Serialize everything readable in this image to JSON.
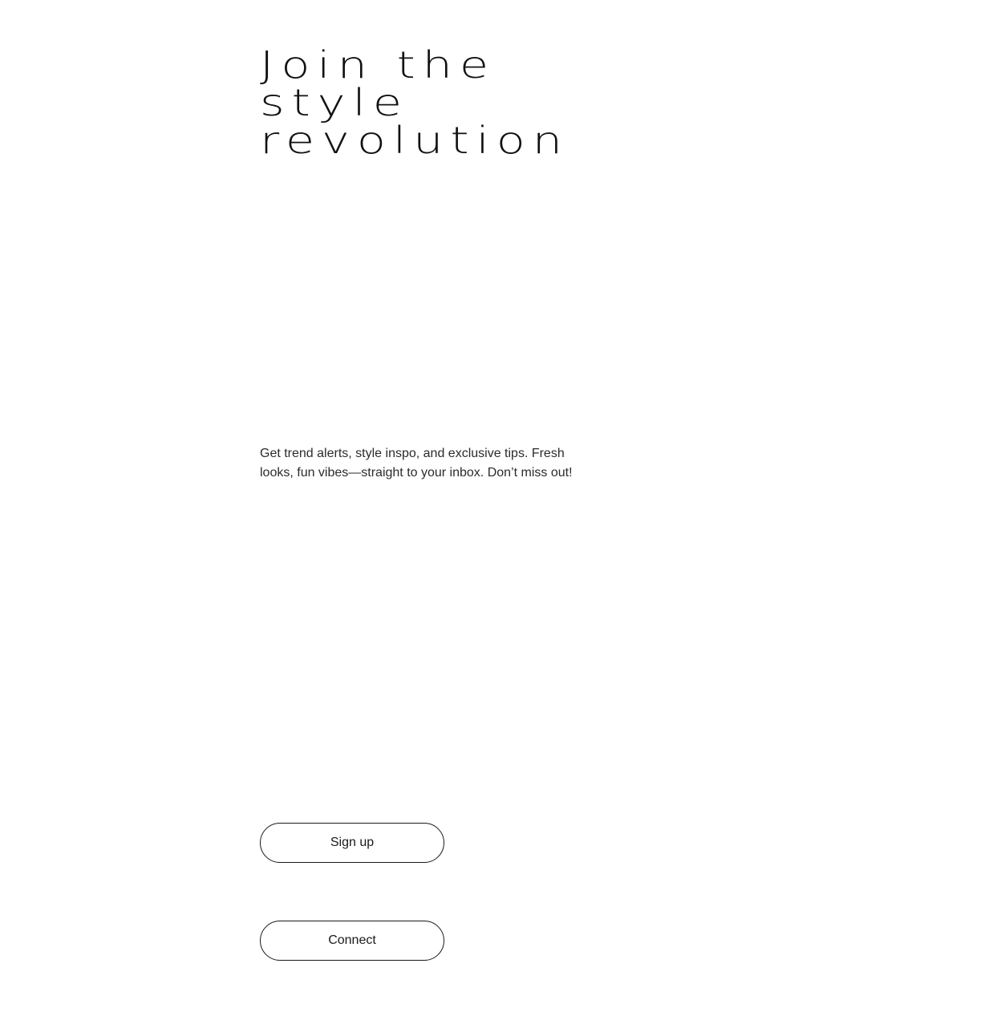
{
  "hero": {
    "title_lines": [
      "Join the",
      "style",
      "revolution"
    ],
    "description": "Get trend alerts, style inspo, and exclusive tips. Fresh looks, fun vibes—straight to your inbox. Don’t miss out!"
  },
  "actions": {
    "signup_label": "Sign up",
    "connect_label": "Connect"
  }
}
